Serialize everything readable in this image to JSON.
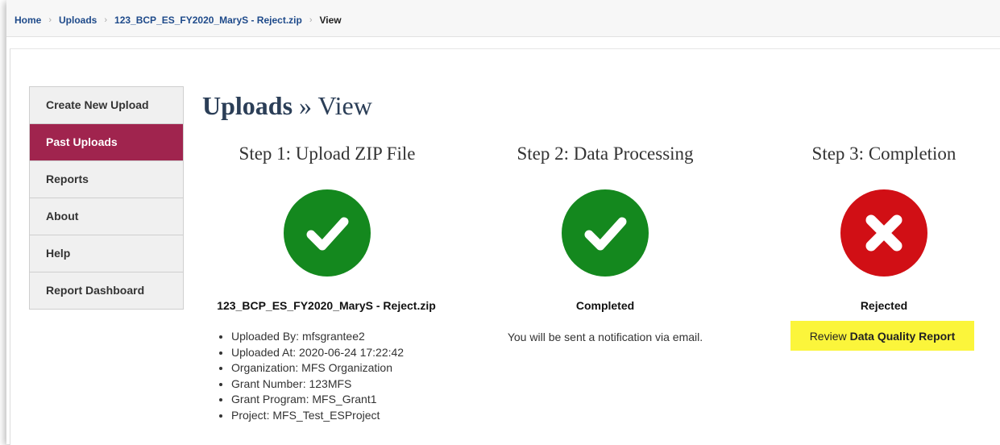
{
  "breadcrumb": {
    "items": [
      "Home",
      "Uploads",
      "123_BCP_ES_FY2020_MaryS - Reject.zip"
    ],
    "current": "View"
  },
  "sidebar": {
    "items": [
      {
        "label": "Create New Upload",
        "active": false
      },
      {
        "label": "Past Uploads",
        "active": true
      },
      {
        "label": "Reports",
        "active": false
      },
      {
        "label": "About",
        "active": false
      },
      {
        "label": "Help",
        "active": false
      },
      {
        "label": "Report Dashboard",
        "active": false
      }
    ]
  },
  "page": {
    "title_strong": "Uploads",
    "title_rest": " » View"
  },
  "steps": [
    {
      "title": "Step 1: Upload ZIP File",
      "status": "ok",
      "label": "123_BCP_ES_FY2020_MaryS - Reject.zip"
    },
    {
      "title": "Step 2: Data Processing",
      "status": "ok",
      "label": "Completed",
      "note": "You will be sent a notification via email."
    },
    {
      "title": "Step 3: Completion",
      "status": "error",
      "label": "Rejected"
    }
  ],
  "details": [
    "Uploaded By: mfsgrantee2",
    "Uploaded At: 2020-06-24 17:22:42",
    "Organization: MFS Organization",
    "Grant Number: 123MFS",
    "Grant Program: MFS_Grant1",
    "Project: MFS_Test_ESProject"
  ],
  "review": {
    "prefix": "Review",
    "link": "Data Quality Report"
  },
  "colors": {
    "active_nav": "#a0244e",
    "success": "#14881e",
    "error": "#d10f15",
    "highlight": "#fbf53b"
  },
  "icons": {
    "success": "check-icon",
    "error": "x-icon"
  }
}
